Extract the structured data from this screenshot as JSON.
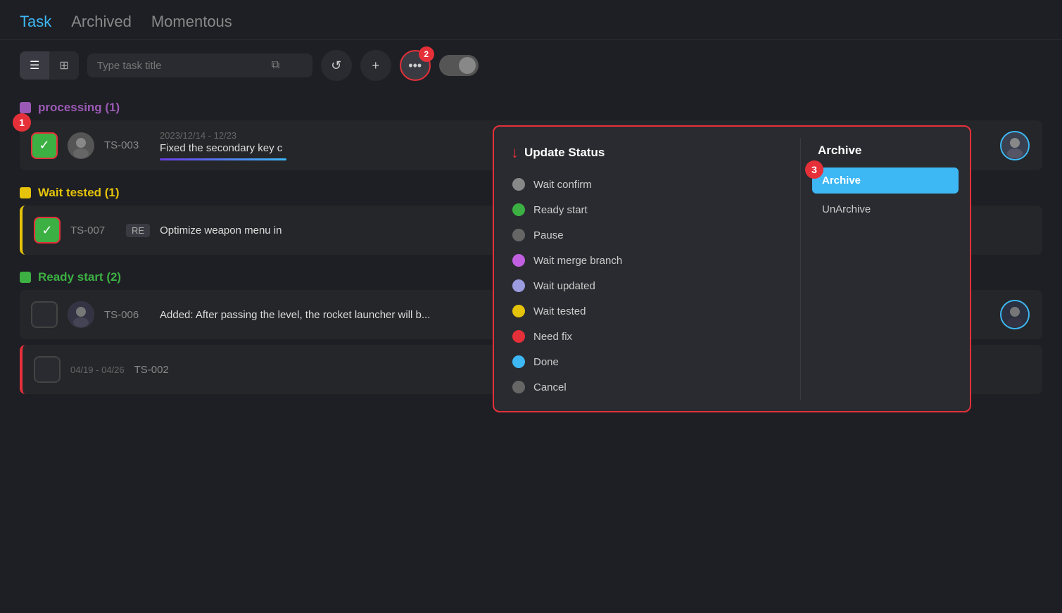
{
  "nav": {
    "tabs": [
      {
        "label": "Task",
        "active": true
      },
      {
        "label": "Archived",
        "active": false
      },
      {
        "label": "Momentous",
        "active": false
      }
    ]
  },
  "toolbar": {
    "search_placeholder": "Type task title",
    "badge_step2": "2",
    "badge_step1": "1",
    "badge_step3": "3"
  },
  "groups": [
    {
      "id": "processing",
      "label": "processing",
      "count": 1,
      "color": "#9b59b6",
      "tasks": [
        {
          "id": "TS-003",
          "date": "2023/12/14 - 12/23",
          "desc": "Fixed the secondary key c",
          "checked": true,
          "has_progress": true
        }
      ]
    },
    {
      "id": "wait-tested",
      "label": "Wait tested",
      "count": 1,
      "color": "#e5c30a",
      "tasks": [
        {
          "id": "TS-007",
          "tag": "RE",
          "desc": "Optimize weapon menu in",
          "checked": true
        }
      ]
    },
    {
      "id": "ready-start",
      "label": "Ready start",
      "count": 2,
      "color": "#3cb043",
      "tasks": [
        {
          "id": "TS-006",
          "desc": "Added: After passing the level, the rocket launcher will b...",
          "checked": false
        },
        {
          "id": "TS-002",
          "date": "04/19 - 04/26",
          "desc": "",
          "checked": false
        }
      ]
    }
  ],
  "dropdown": {
    "title_update": "Update Status",
    "title_archive": "Archive",
    "statuses": [
      {
        "label": "Wait confirm",
        "color": "#888"
      },
      {
        "label": "Ready start",
        "color": "#3cb043"
      },
      {
        "label": "Pause",
        "color": "#666"
      },
      {
        "label": "Wait merge branch",
        "color": "#c060e0"
      },
      {
        "label": "Wait updated",
        "color": "#9b9be0"
      },
      {
        "label": "Wait tested",
        "color": "#e5c30a"
      },
      {
        "label": "Need fix",
        "color": "#e5303a"
      },
      {
        "label": "Done",
        "color": "#3db8f5"
      },
      {
        "label": "Cancel",
        "color": "#666"
      }
    ],
    "archive_options": [
      {
        "label": "Archive",
        "active": true
      },
      {
        "label": "UnArchive",
        "active": false
      }
    ]
  }
}
